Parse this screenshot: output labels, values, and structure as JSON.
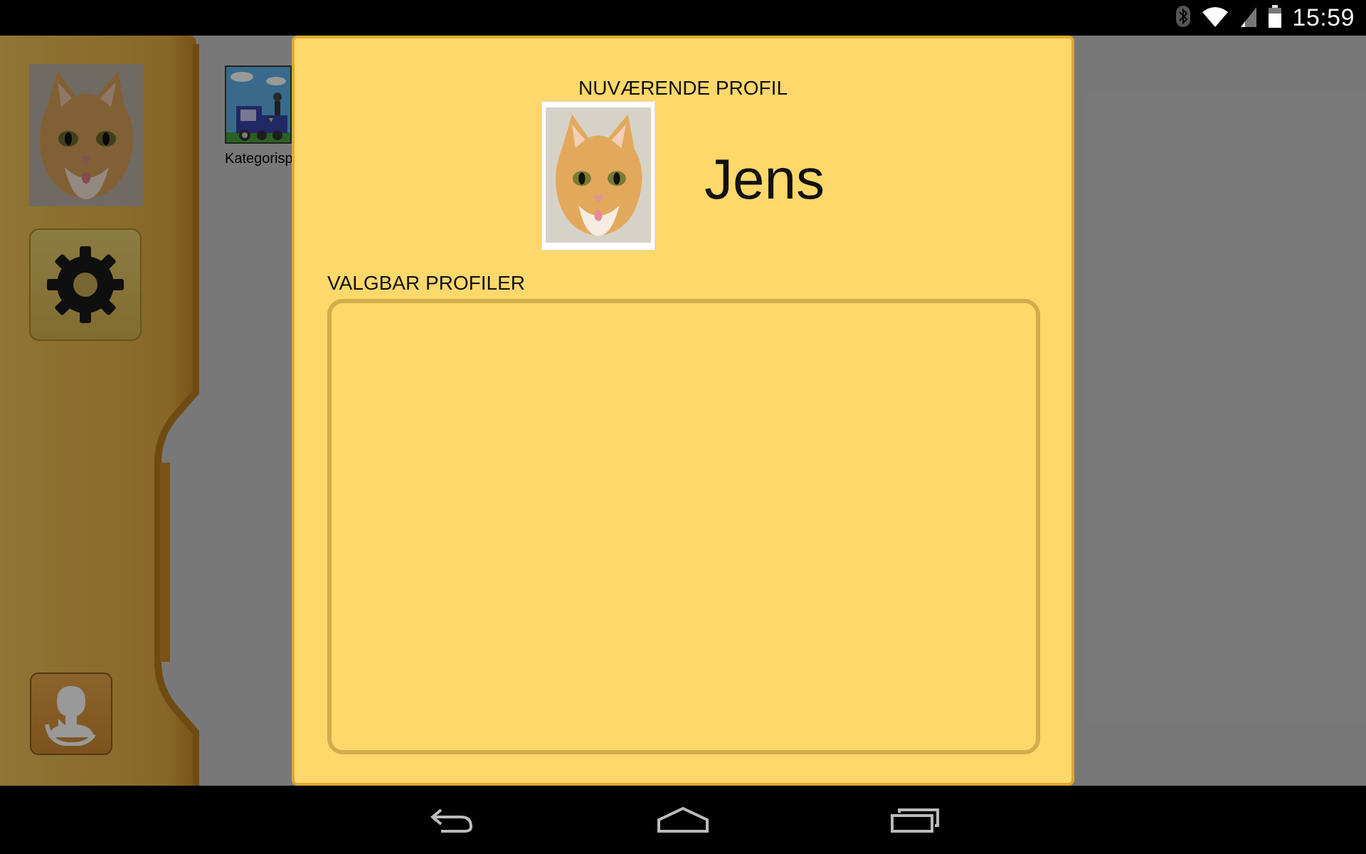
{
  "status_bar": {
    "time": "15:59",
    "icons": [
      "bluetooth-icon",
      "wifi-icon",
      "signal-icon",
      "battery-icon"
    ]
  },
  "sidebar": {
    "avatar_icon": "cat-photo",
    "settings_icon": "gear-icon",
    "logout_icon": "logout-icon"
  },
  "apps": [
    {
      "label": "Kategorisp",
      "icon": "train-picture"
    }
  ],
  "dialog": {
    "current_profile_title": "NUVÆRENDE PROFIL",
    "current_profile_name": "Jens",
    "selectable_profiles_title": "VALGBAR PROFILER",
    "selectable_profiles": []
  },
  "nav_bar": {
    "buttons": [
      "back-icon",
      "home-icon",
      "recents-icon"
    ]
  },
  "colors": {
    "dialog_bg": "#ffd86b",
    "dialog_border": "#dcaa2e",
    "sidebar": "#e7b74a"
  }
}
